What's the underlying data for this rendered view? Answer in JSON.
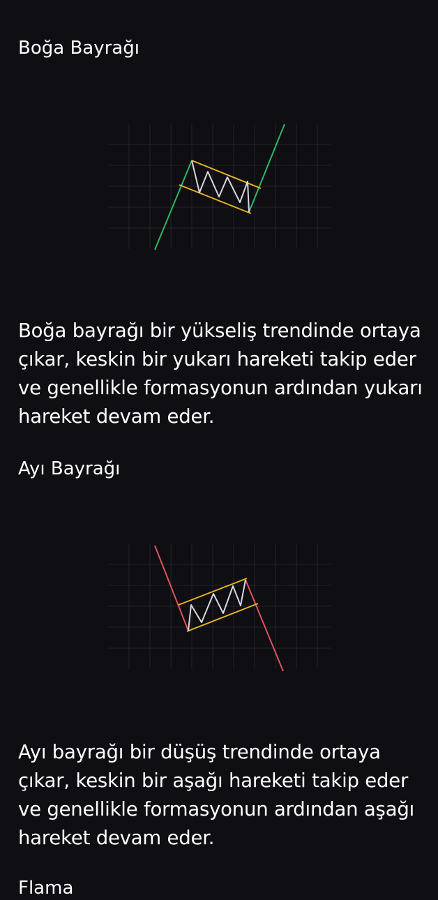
{
  "sections": [
    {
      "title": "Boğa Bayrağı",
      "description": "Boğa bayrağı bir yükseliş trendinde ortaya çıkar, keskin bir yukarı hareketi takip eder ve genellikle formasyonun ardından yukarı hareket devam eder.",
      "figure_icon": "bull-flag-pattern-icon",
      "trend_color": "#2fb864"
    },
    {
      "title": "Ayı Bayrağı",
      "description": "Ayı bayrağı bir düşüş trendinde ortaya çıkar, keskin bir aşağı hareketi takip eder ve genellikle formasyonun ardından aşağı hareket devam eder.",
      "figure_icon": "bear-flag-pattern-icon",
      "trend_color": "#e0545a"
    },
    {
      "title": "Flama"
    }
  ],
  "colors": {
    "background": "#0e0e13",
    "channel": "#e6b422",
    "zigzag": "#d8d8e0",
    "grid": "#24242c"
  }
}
